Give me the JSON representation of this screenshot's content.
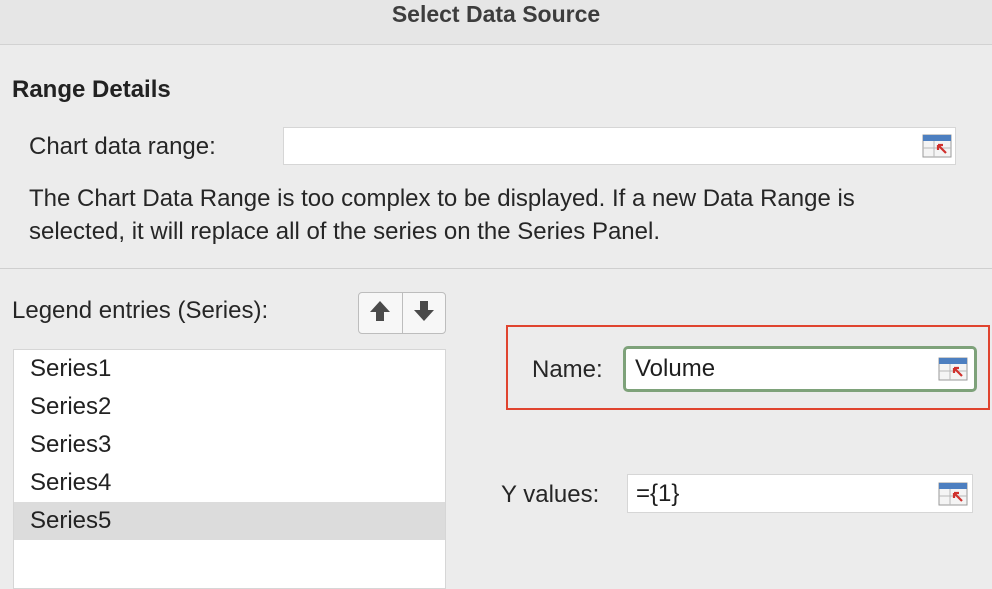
{
  "dialog": {
    "title": "Select Data Source"
  },
  "range_details": {
    "heading": "Range Details",
    "chart_data_range_label": "Chart data range:",
    "chart_data_range_value": "",
    "info_text": "The Chart Data Range is too complex to be displayed. If a new Data Range is selected, it will replace all of the series on the Series Panel."
  },
  "series_panel": {
    "label": "Legend entries (Series):",
    "move_up_icon": "arrow-up-icon",
    "move_down_icon": "arrow-down-icon",
    "items": [
      {
        "label": "Series1",
        "selected": false
      },
      {
        "label": "Series2",
        "selected": false
      },
      {
        "label": "Series3",
        "selected": false
      },
      {
        "label": "Series4",
        "selected": false
      },
      {
        "label": "Series5",
        "selected": true
      }
    ]
  },
  "series_detail": {
    "name_label": "Name:",
    "name_value": "Volume",
    "y_values_label": "Y values:",
    "y_values_value": "={1}"
  },
  "colors": {
    "highlight": "#e0442f",
    "focus_ring": "#7ea27a",
    "selected_row": "#dcdcdc"
  }
}
